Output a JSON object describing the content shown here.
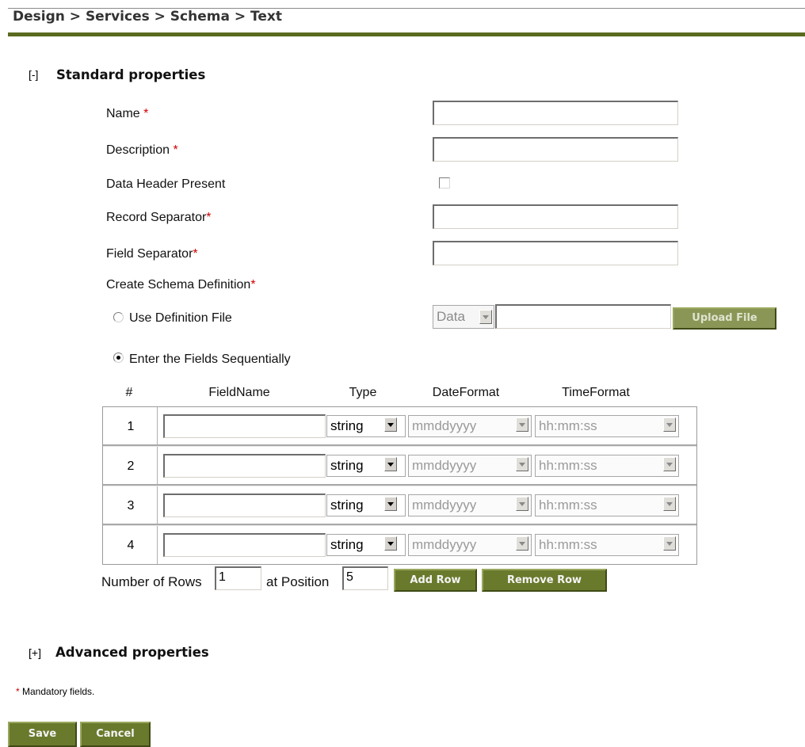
{
  "breadcrumb": "Design > Services > Schema > Text",
  "standard": {
    "toggle": "[-]",
    "title": "Standard properties",
    "fields": {
      "name": "Name",
      "description": "Description",
      "data_header": "Data Header Present",
      "record_separator": "Record Separator",
      "field_separator": "Field Separator",
      "create_schema": "Create Schema Definition"
    },
    "required_mark": "*",
    "use_definition_file": "Use Definition File",
    "definition_type": "Data",
    "upload_label": "Upload File",
    "enter_fields": "Enter the Fields Sequentially",
    "selected_option": "Enter the Fields Sequentially"
  },
  "table": {
    "headers": [
      "#",
      "FieldName",
      "Type",
      "DateFormat",
      "TimeFormat"
    ],
    "rows": [
      {
        "num": "1",
        "field_name": "",
        "type": "string",
        "date_format": "mmddyyyy",
        "time_format": "hh:mm:ss"
      },
      {
        "num": "2",
        "field_name": "",
        "type": "string",
        "date_format": "mmddyyyy",
        "time_format": "hh:mm:ss"
      },
      {
        "num": "3",
        "field_name": "",
        "type": "string",
        "date_format": "mmddyyyy",
        "time_format": "hh:mm:ss"
      },
      {
        "num": "4",
        "field_name": "",
        "type": "string",
        "date_format": "mmddyyyy",
        "time_format": "hh:mm:ss"
      }
    ]
  },
  "row_controls": {
    "num_rows_label": "Number of Rows",
    "num_rows_value": "1",
    "position_label": "at Position",
    "position_value": "5",
    "add_row": "Add Row",
    "remove_row": "Remove Row"
  },
  "advanced": {
    "toggle": "[+]",
    "title": "Advanced properties"
  },
  "footer": {
    "mandatory_mark": "*",
    "mandatory_note": "Mandatory fields.",
    "save": "Save",
    "cancel": "Cancel"
  },
  "colors": {
    "accent_green": "#697a2c",
    "required_red": "#d00000"
  }
}
